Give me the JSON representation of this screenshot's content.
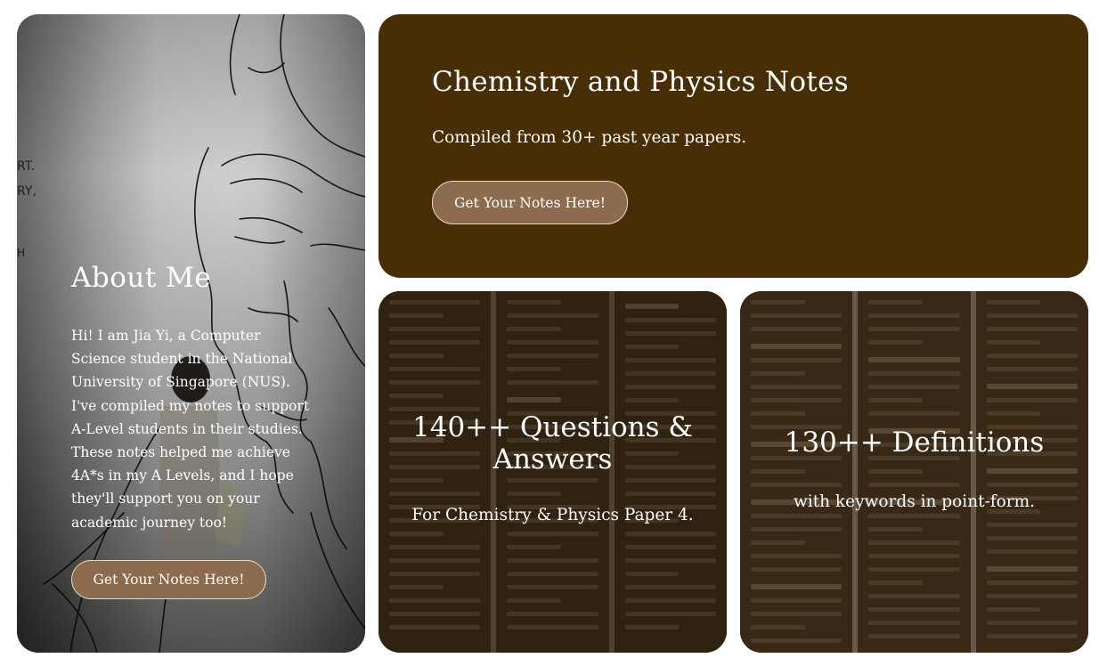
{
  "about": {
    "heading": "About Me",
    "body": "Hi! I am Jia Yi, a Computer Science student in the National University of Singapore (NUS). I've compiled my notes to support A-Level students in their studies. These notes helped me achieve 4A*s in my A Levels, and I hope they'll support you on your academic journey too!",
    "button_label": "Get Your Notes Here!"
  },
  "hero": {
    "title": "Chemistry and Physics Notes",
    "subtitle": "Compiled from 30+ past year papers.",
    "button_label": "Get Your Notes Here!",
    "background_color": "#472e07"
  },
  "questions_card": {
    "title": "140++ Questions & Answers",
    "description": "For Chemistry & Physics Paper 4."
  },
  "definitions_card": {
    "title": "130++ Definitions",
    "description": "with keywords in point-form."
  },
  "colors": {
    "button": "#8c6b4e",
    "card_dark": "#3a2a18"
  }
}
